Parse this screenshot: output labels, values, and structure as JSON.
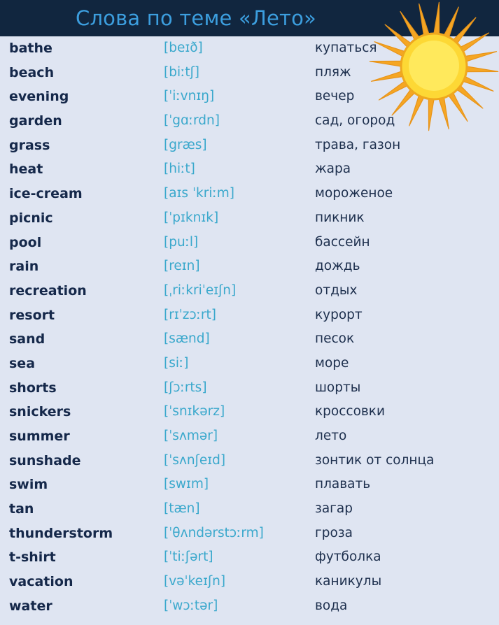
{
  "header": {
    "title": "Слова по теме «Лето»",
    "bar_color": "#11263f",
    "title_color": "#3c9ede"
  },
  "decoration": {
    "sun_icon": "sun-icon",
    "core_color": "#FDD835",
    "core_highlight_color": "#FFE95C",
    "ray_color": "#F5A623",
    "ray_count": 20
  },
  "page": {
    "background_color": "#dfe5f2",
    "word_color": "#15284a",
    "ipa_color": "#3aa8cc",
    "translation_color": "#1d2f4d"
  },
  "table": {
    "columns": [
      "word",
      "transcription",
      "translation"
    ],
    "rows": [
      {
        "word": "bathe",
        "ipa": "[beɪð]",
        "translation": "купаться"
      },
      {
        "word": "beach",
        "ipa": "[biːtʃ]",
        "translation": "пляж"
      },
      {
        "word": "evening",
        "ipa": "[ˈiːvnɪŋ]",
        "translation": "вечер"
      },
      {
        "word": "garden",
        "ipa": "[ˈgɑːrdn]",
        "translation": "сад, огород"
      },
      {
        "word": "grass",
        "ipa": "[græs]",
        "translation": "трава, газон"
      },
      {
        "word": "heat",
        "ipa": "[hiːt]",
        "translation": "жара"
      },
      {
        "word": "ice-cream",
        "ipa": "[aɪs ˈkriːm]",
        "translation": "мороженое"
      },
      {
        "word": "picnic",
        "ipa": "[ˈpɪknɪk]",
        "translation": "пикник"
      },
      {
        "word": "pool",
        "ipa": "[puːl]",
        "translation": "бассейн"
      },
      {
        "word": "rain",
        "ipa": "[reɪn]",
        "translation": "дождь"
      },
      {
        "word": "recreation",
        "ipa": "[ˌriːkriˈeɪʃn]",
        "translation": "отдых"
      },
      {
        "word": "resort",
        "ipa": "[rɪˈzɔːrt]",
        "translation": "курорт"
      },
      {
        "word": "sand",
        "ipa": "[sænd]",
        "translation": "песок"
      },
      {
        "word": "sea",
        "ipa": "[siː]",
        "translation": "море"
      },
      {
        "word": "shorts",
        "ipa": "[ʃɔːrts]",
        "translation": "шорты"
      },
      {
        "word": "snickers",
        "ipa": "[ˈsnɪkərz]",
        "translation": "кроссовки"
      },
      {
        "word": "summer",
        "ipa": "[ˈsʌmər]",
        "translation": "лето"
      },
      {
        "word": "sunshade",
        "ipa": "[ˈsʌnʃeɪd]",
        "translation": "зонтик от солнца"
      },
      {
        "word": "swim",
        "ipa": "[swɪm]",
        "translation": "плавать"
      },
      {
        "word": "tan",
        "ipa": "[tæn]",
        "translation": "загар"
      },
      {
        "word": "thunderstorm",
        "ipa": "[ˈθʌndərstɔːrm]",
        "translation": "гроза"
      },
      {
        "word": "t-shirt",
        "ipa": "[ˈtiːʃərt]",
        "translation": "футболка"
      },
      {
        "word": "vacation",
        "ipa": "[vəˈkeɪʃn]",
        "translation": "каникулы"
      },
      {
        "word": "water",
        "ipa": "[ˈwɔːtər]",
        "translation": "вода"
      }
    ]
  }
}
